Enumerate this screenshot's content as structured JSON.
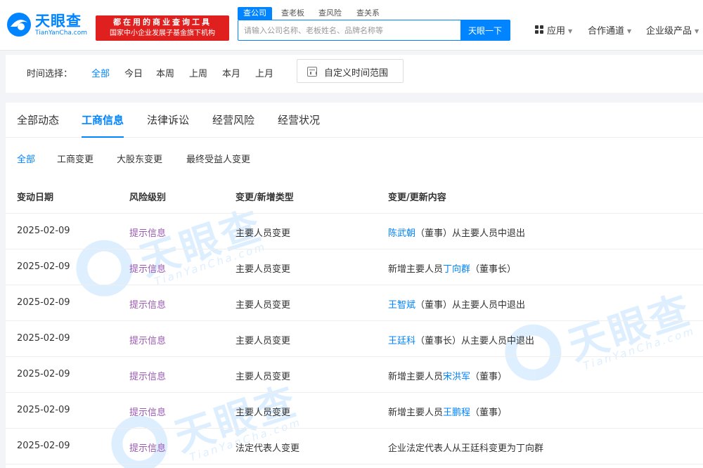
{
  "header": {
    "logo_text": "天眼查",
    "logo_subtext": "TianYanCha.com",
    "slogan_line1": "都在用的商业查询工具",
    "slogan_line2": "国家中小企业发展子基金旗下机构",
    "search_tabs": [
      "查公司",
      "查老板",
      "查风险",
      "查关系"
    ],
    "search_placeholder": "请输入公司名称、老板姓名、品牌名称等",
    "search_button": "天眼一下",
    "nav": [
      "应用",
      "合作通道",
      "企业级产品"
    ]
  },
  "time_filter": {
    "label": "时间选择：",
    "options": [
      "全部",
      "今日",
      "本周",
      "上周",
      "本月",
      "上月"
    ],
    "selected": "全部",
    "custom_range": "自定义时间范围"
  },
  "main_tabs": {
    "items": [
      "全部动态",
      "工商信息",
      "法律诉讼",
      "经营风险",
      "经营状况"
    ],
    "selected": "工商信息"
  },
  "sub_tabs": {
    "items": [
      "全部",
      "工商变更",
      "大股东变更",
      "最终受益人变更"
    ],
    "selected": "全部"
  },
  "table": {
    "headers": [
      "变动日期",
      "风险级别",
      "变更/新增类型",
      "变更/更新内容"
    ],
    "rows": [
      {
        "date": "2025-02-09",
        "risk": "提示信息",
        "type": "主要人员变更",
        "c_pre": "",
        "c_link": "陈武朝",
        "c_post": "（董事）从主要人员中退出"
      },
      {
        "date": "2025-02-09",
        "risk": "提示信息",
        "type": "主要人员变更",
        "c_pre": "新增主要人员",
        "c_link": "丁向群",
        "c_post": "（董事长）"
      },
      {
        "date": "2025-02-09",
        "risk": "提示信息",
        "type": "主要人员变更",
        "c_pre": "",
        "c_link": "王智斌",
        "c_post": "（董事）从主要人员中退出"
      },
      {
        "date": "2025-02-09",
        "risk": "提示信息",
        "type": "主要人员变更",
        "c_pre": "",
        "c_link": "王廷科",
        "c_post": "（董事长）从主要人员中退出"
      },
      {
        "date": "2025-02-09",
        "risk": "提示信息",
        "type": "主要人员变更",
        "c_pre": "新增主要人员",
        "c_link": "宋洪军",
        "c_post": "（董事）"
      },
      {
        "date": "2025-02-09",
        "risk": "提示信息",
        "type": "主要人员变更",
        "c_pre": "新增主要人员",
        "c_link": "王鹏程",
        "c_post": "（董事）"
      },
      {
        "date": "2025-02-09",
        "risk": "提示信息",
        "type": "法定代表人变更",
        "c_pre": "企业法定代表人从王廷科变更为丁向群",
        "c_link": "",
        "c_post": ""
      }
    ]
  },
  "watermark": {
    "text": "天眼查",
    "subtext": "TianYanCha.com"
  },
  "colors": {
    "brand_blue": "#0084ff",
    "slogan_red": "#e0201e",
    "risk_purple": "#9b59b6"
  }
}
